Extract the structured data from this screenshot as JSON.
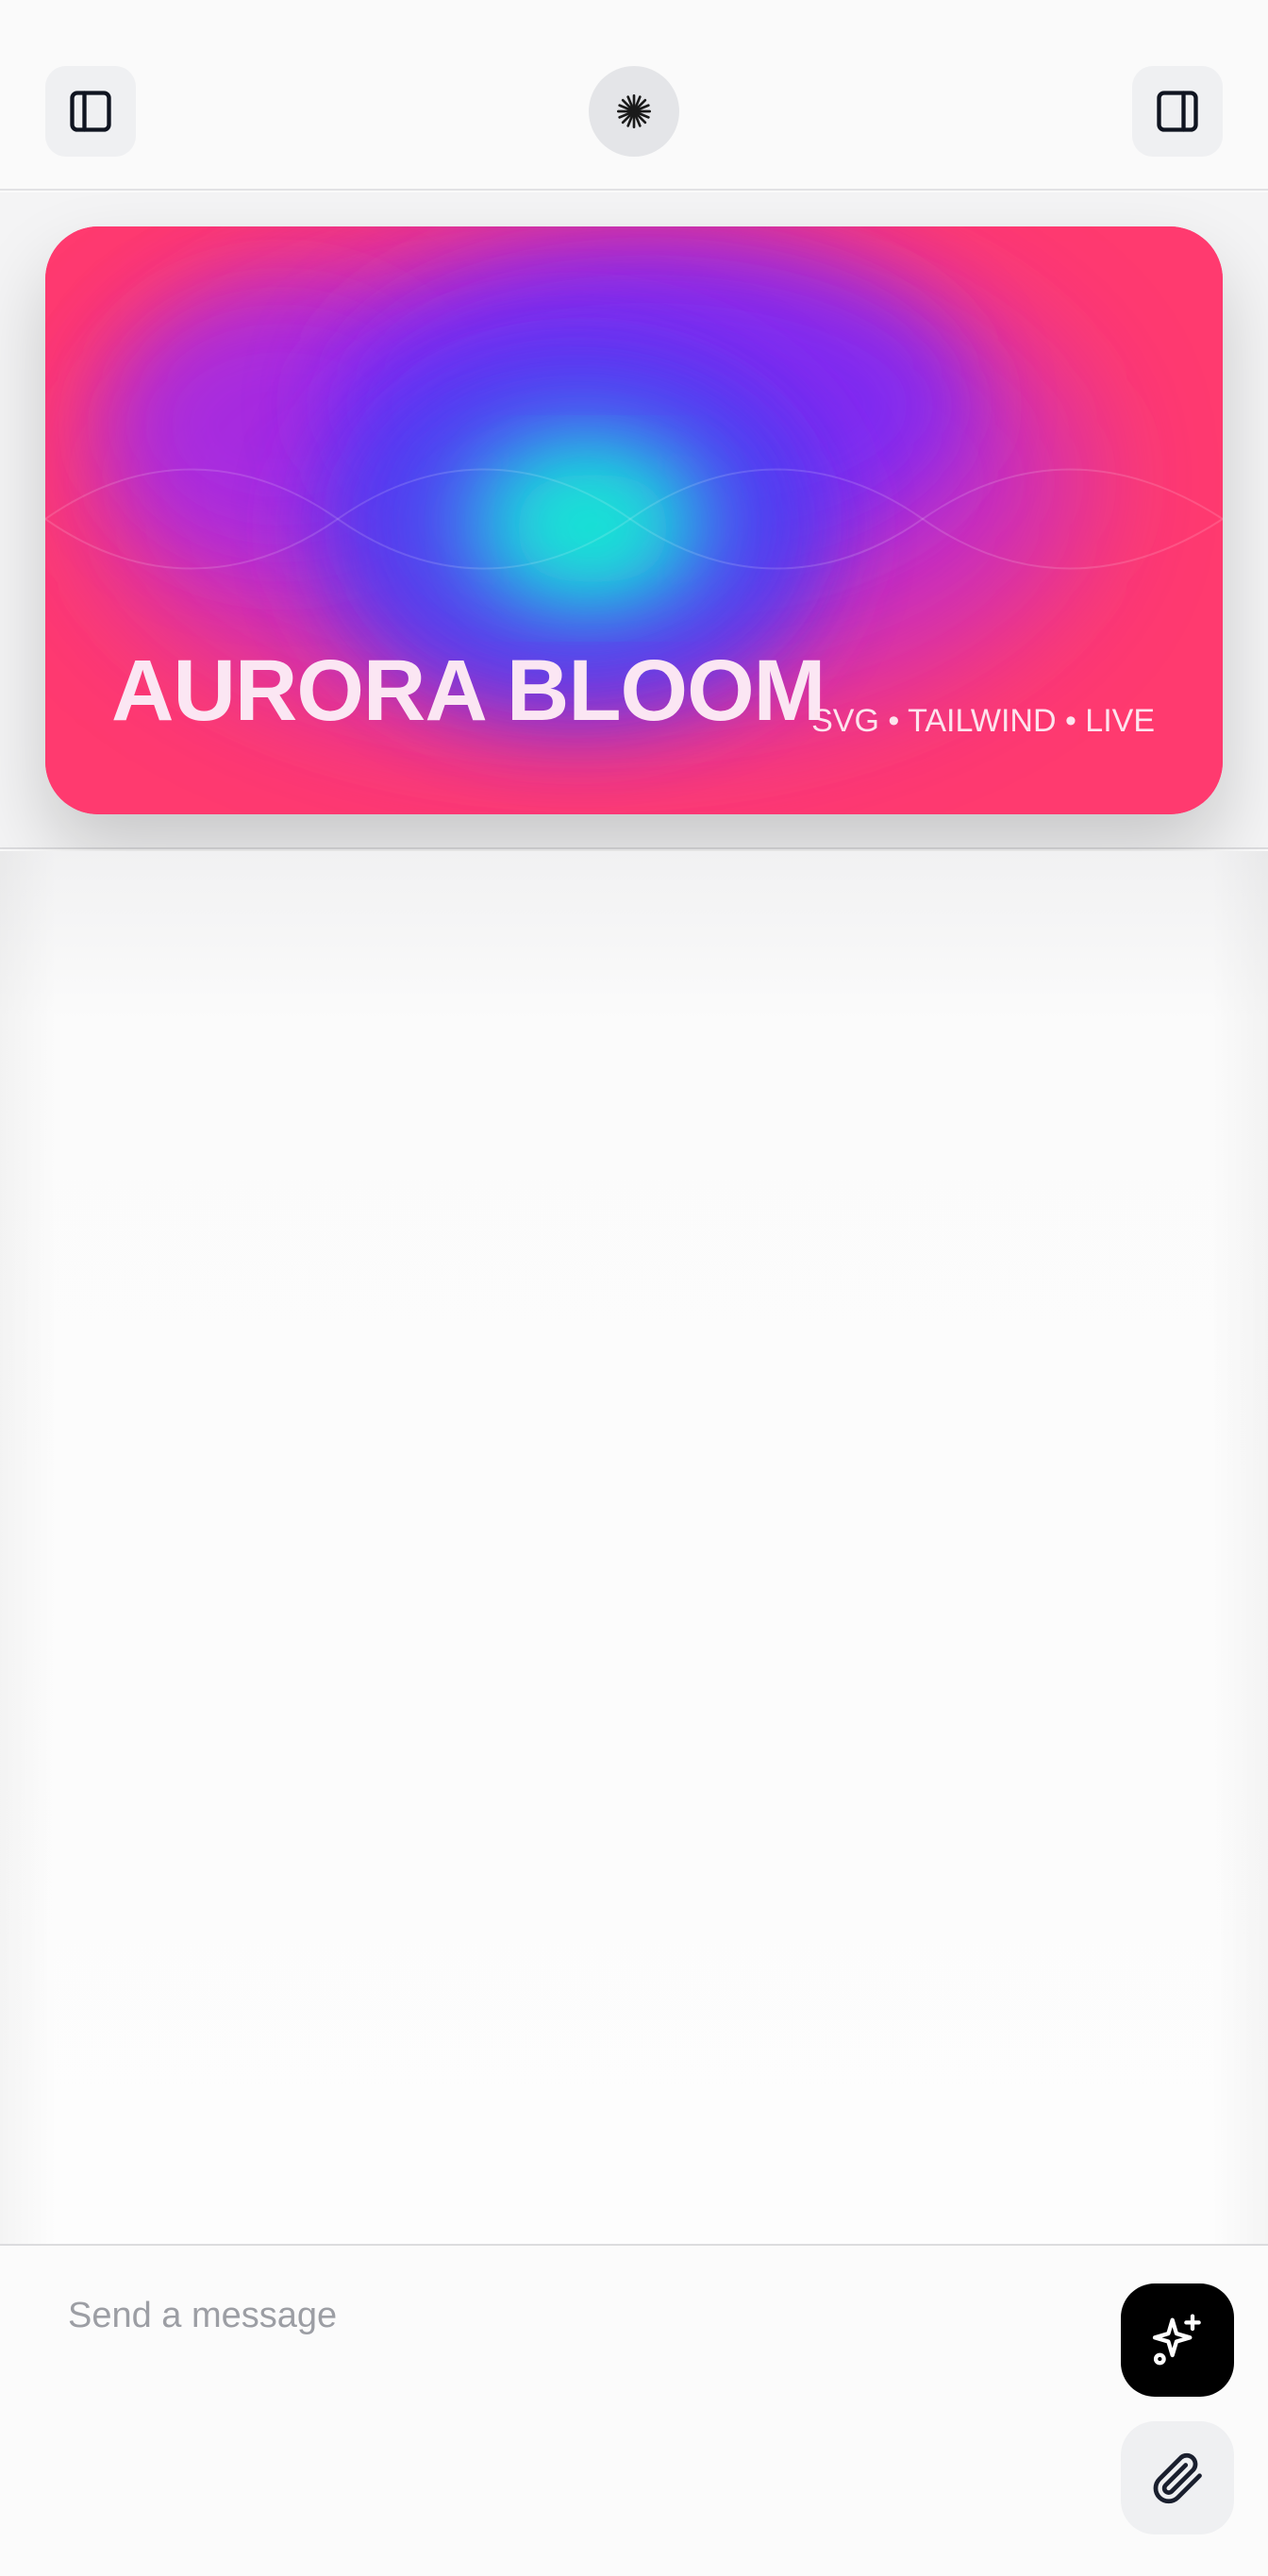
{
  "header": {
    "left_icon": "sidebar-left-icon",
    "center_icon": "sparkle-burst-icon",
    "right_icon": "sidebar-right-icon"
  },
  "banner": {
    "title": "AURORA BLOOM",
    "tags": "SVG • TAILWIND • LIVE",
    "colors": {
      "base": "#ff3a6f",
      "violet": "#8a2cf5",
      "blue": "#4a3df2",
      "cyan": "#0de8d2"
    }
  },
  "composer": {
    "placeholder": "Send a message",
    "send_icon": "sparkles-icon",
    "attach_icon": "paperclip-icon"
  }
}
